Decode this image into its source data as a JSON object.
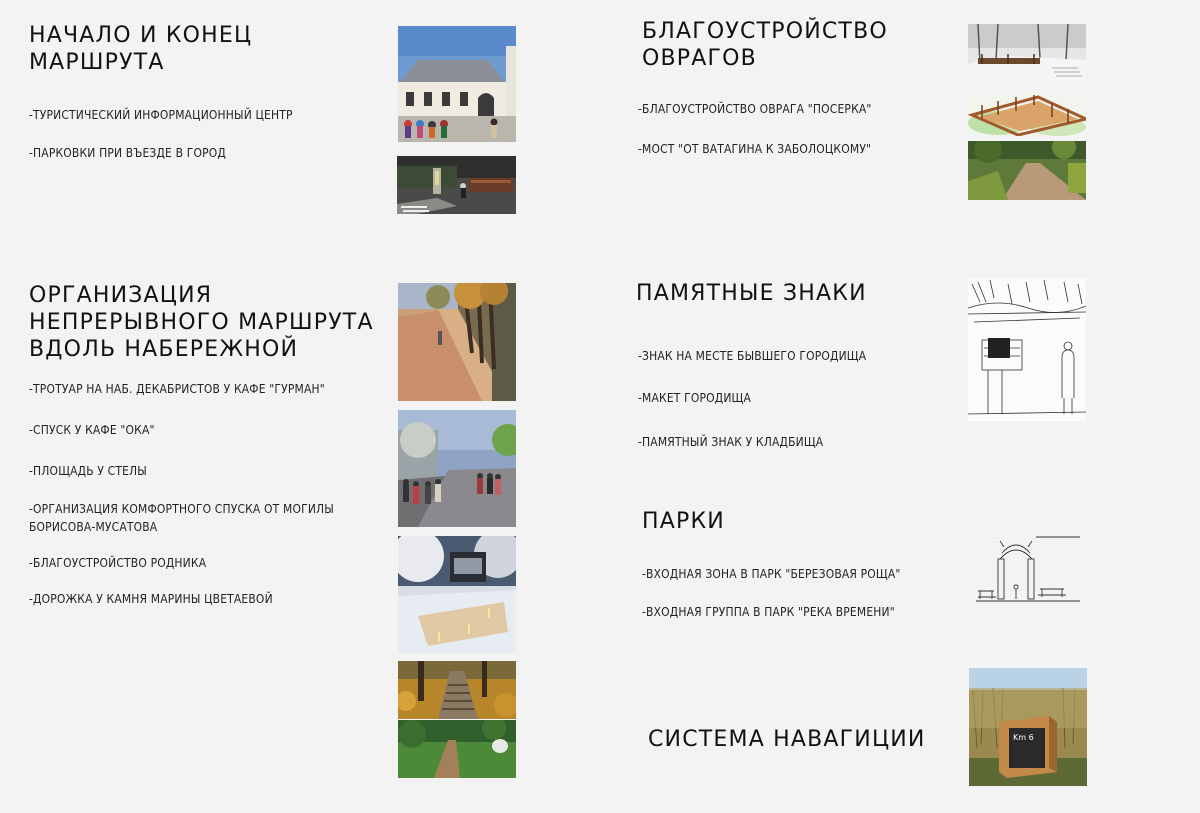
{
  "sections": {
    "start": {
      "heading_line1": "НАЧАЛО И КОНЕЦ",
      "heading_line2": "МАРШРУТА",
      "items": [
        "-ТУРИСТИЧЕСКИЙ ИНФОРМАЦИОННЫЙ ЦЕНТР",
        "-ПАРКОВКИ ПРИ ВЪЕЗДЕ В ГОРОД"
      ]
    },
    "continuous": {
      "heading_line1": "ОРГАНИЗАЦИЯ",
      "heading_line2": "НЕПРЕРЫВНОГО МАРШРУТА",
      "heading_line3": "ВДОЛЬ НАБЕРЕЖНОЙ",
      "items": [
        "-ТРОТУАР НА НАБ. ДЕКАБРИСТОВ У КАФЕ \"ГУРМАН\"",
        "-СПУСК У КАФЕ \"ОКА\"",
        "-ПЛОЩАДЬ У СТЕЛЫ",
        "-ОРГАНИЗАЦИЯ КОМФОРТНОГО СПУСКА ОТ МОГИЛЫ",
        "БОРИСОВА-МУСАТОВА",
        "-БЛАГОУСТРОЙСТВО РОДНИКА",
        "-ДОРОЖКА  У КАМНЯ МАРИНЫ ЦВЕТАЕВОЙ"
      ]
    },
    "ravines": {
      "heading_line1": "БЛАГОУСТРОЙСТВО",
      "heading_line2": "ОВРАГОВ",
      "items": [
        "-БЛАГОУСТРОЙСТВО ОВРАГА \"ПОСЕРКА\"",
        "-МОСТ \"ОТ ВАТАГИНА К ЗАБОЛОЦКОМУ\""
      ]
    },
    "memorial": {
      "heading": "ПАМЯТНЫЕ ЗНАКИ",
      "items": [
        "-ЗНАК НА МЕСТЕ БЫВШЕГО ГОРОДИЩА",
        "-МАКЕТ ГОРОДИЩА",
        "-ПАМЯТНЫЙ ЗНАК  У КЛАДБИЩА"
      ]
    },
    "parks": {
      "heading": "ПАРКИ",
      "items": [
        "-ВХОДНАЯ   ЗОНА В ПАРК \"БЕРЕЗОВАЯ РОЩА\"",
        "-ВХОДНАЯ ГРУППА В ПАРК  \"РЕКА ВРЕМЕНИ\""
      ]
    },
    "navigation": {
      "heading": "СИСТЕМА НАВАГИЦИИ",
      "sign_text": "Km 6"
    }
  }
}
